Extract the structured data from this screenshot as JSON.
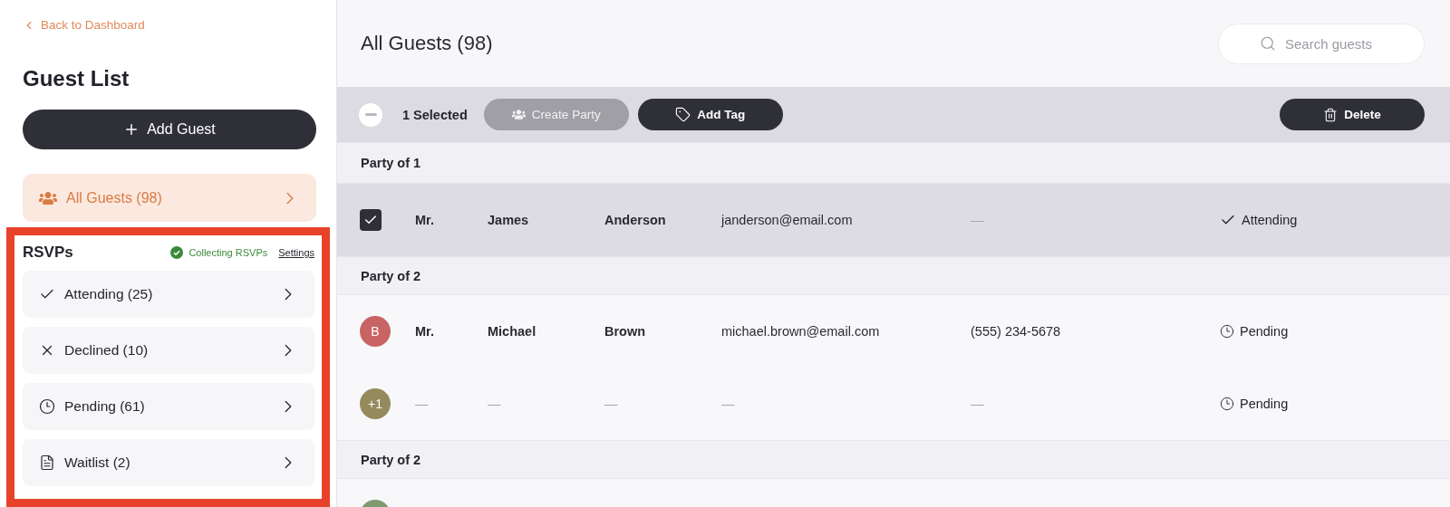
{
  "sidebar": {
    "back_link": "Back to Dashboard",
    "title": "Guest List",
    "add_button": "Add Guest",
    "all_guests": {
      "label": "All Guests (98)",
      "selected": true
    },
    "rsvps": {
      "title": "RSVPs",
      "highlighted": true,
      "status": "Collecting RSVPs",
      "settings_link": "Settings",
      "items": [
        {
          "kind": "attending",
          "label": "Attending (25)"
        },
        {
          "kind": "declined",
          "label": "Declined (10)"
        },
        {
          "kind": "pending",
          "label": "Pending (61)"
        },
        {
          "kind": "waitlist",
          "label": "Waitlist (2)"
        }
      ]
    }
  },
  "main": {
    "title": "All Guests (98)",
    "search": {
      "placeholder": "Search guests"
    },
    "selection_bar": {
      "count": "1 Selected",
      "buttons": [
        {
          "kind": "party",
          "label": "Create Party",
          "disabled": true
        },
        {
          "kind": "tag",
          "label": "Add Tag",
          "disabled": false
        }
      ],
      "delete_button": "Delete"
    },
    "parties": [
      {
        "heading": "Party of 1",
        "guests": [
          {
            "selected": true,
            "title": "Mr.",
            "first_name": "James",
            "last_name": "Anderson",
            "email": "janderson@email.com",
            "phone": "—",
            "status": {
              "kind": "attending",
              "label": "Attending"
            }
          }
        ]
      },
      {
        "heading": "Party of 2",
        "guests": [
          {
            "selected": false,
            "avatar": {
              "initial": "B",
              "color": "#c96464"
            },
            "title": "Mr.",
            "first_name": "Michael",
            "last_name": "Brown",
            "email": "michael.brown@email.com",
            "phone": "(555) 234-5678",
            "status": {
              "kind": "pending",
              "label": "Pending"
            }
          },
          {
            "selected": false,
            "avatar": {
              "initial": "+1",
              "color": "#958a5c"
            },
            "title": "—",
            "first_name": "—",
            "last_name": "—",
            "email": "—",
            "phone": "—",
            "status": {
              "kind": "pending",
              "label": "Pending"
            }
          }
        ]
      },
      {
        "heading": "Party of 2",
        "guests": [
          {
            "selected": false,
            "avatar": {
              "color": "#7f9a6f"
            }
          }
        ]
      }
    ]
  }
}
